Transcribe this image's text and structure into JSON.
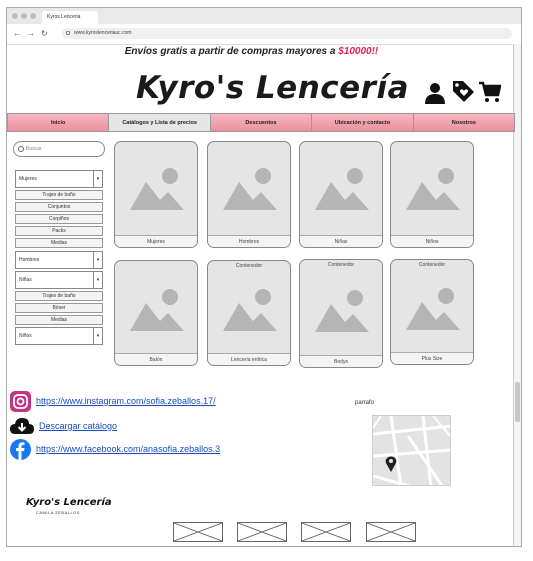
{
  "browser": {
    "tab_title": "Kyros Lenceria",
    "url": "www.kyroslenceriauc.com",
    "nav_back": "←",
    "nav_forward": "→",
    "nav_reload": "↻"
  },
  "promo": {
    "text": "Envíos gratis a partir de compras mayores a ",
    "amount": "$10000!!"
  },
  "brand": {
    "title": "Kyro's Lencería"
  },
  "menu": {
    "items": [
      {
        "label": "Inicio"
      },
      {
        "label": "Catálogos y Lista de precios"
      },
      {
        "label": "Descuentos"
      },
      {
        "label": "Ubicación y contacto"
      },
      {
        "label": "Nosotros"
      }
    ],
    "active_index": 1
  },
  "sidebar": {
    "search_placeholder": "Buscar",
    "select_mujeres": "Mujeres",
    "mujeres_items": [
      "Trajes de baño",
      "Conjuntos",
      "Corpiños",
      "Packs",
      "Medias"
    ],
    "select_hombres": "Hombres",
    "select_ninas": "Niñas",
    "ninas_items": [
      "Trajes de baño",
      "Bóxer",
      "Medias"
    ],
    "select_ninos": "Niños",
    "arrow": "▾"
  },
  "products": {
    "row1": [
      {
        "caption": "Mujeres"
      },
      {
        "caption": "Hombres"
      },
      {
        "caption": "Niñas"
      },
      {
        "caption": "Niños"
      }
    ],
    "row2": [
      {
        "header": "",
        "caption": "Batón"
      },
      {
        "header": "Contenedor",
        "caption": "Lencería erótica"
      },
      {
        "header": "Contenedor",
        "caption": "Bodys"
      },
      {
        "header": "Contenedor",
        "caption": "Plus Size"
      }
    ]
  },
  "contact": {
    "instagram": "https://www.instagram.com/sofia.zeballos.17/",
    "catalog": "Descargar catálogo",
    "facebook": "https://www.facebook.com/anasofia.zeballos.3",
    "paragraph_label": "parrafo"
  },
  "footer": {
    "logo": "Kyro's Lencería",
    "subtitle": "CAMILA ZEBALLOS"
  },
  "colors": {
    "menu_pink": "#ec8f9e",
    "promo_amount": "#e0245e",
    "link": "#1a4bb8",
    "instagram": "#c13584",
    "facebook": "#1877f2"
  }
}
